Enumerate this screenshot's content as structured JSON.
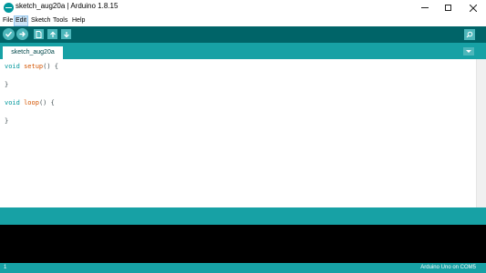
{
  "window": {
    "title": "sketch_aug20a | Arduino 1.8.15",
    "app_icon": "arduino-icon",
    "controls": [
      "minimize-icon",
      "maximize-icon",
      "close-icon"
    ]
  },
  "menu": {
    "items": [
      "File",
      "Edit",
      "Sketch",
      "Tools",
      "Help"
    ],
    "highlighted": "Edit"
  },
  "toolbar": {
    "buttons": [
      "verify-icon",
      "upload-icon",
      "new-icon",
      "open-icon",
      "save-icon",
      "serial-monitor-icon"
    ]
  },
  "tabs": {
    "active": "sketch_aug20a",
    "menu_icon": "tab-menu-icon"
  },
  "editor": {
    "lines": [
      {
        "kw": "void",
        "fn": "setup",
        "rest": "() {"
      },
      {
        "text": "}"
      },
      {
        "kw": "void",
        "fn": "loop",
        "rest": "() {"
      },
      {
        "text": "}"
      }
    ]
  },
  "footer": {
    "line_number": "1",
    "board": "Arduino Uno on COM5"
  },
  "colors": {
    "toolbar": "#006468",
    "tabbar": "#17a1a5",
    "console": "#000000",
    "keyword": "#00979c",
    "function": "#d35400"
  }
}
